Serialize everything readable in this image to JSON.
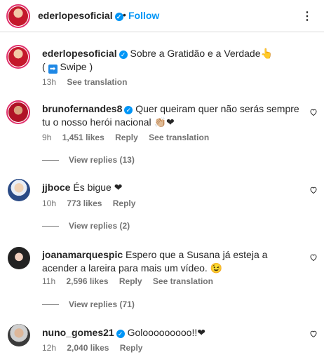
{
  "header": {
    "username": "ederlopesoficial",
    "verified_mark": "✓",
    "separator": "•",
    "follow_label": "Follow",
    "more_icon": "⋮"
  },
  "caption": {
    "username": "ederlopesoficial",
    "text": "Sobre a Gratidão e a Verdade👆",
    "text2_pre": "(",
    "swipe_icon": "➡",
    "text2_post": "Swipe )",
    "time": "13h",
    "see_translation": "See translation"
  },
  "comments": [
    {
      "username": "brunofernandes8",
      "verified": true,
      "text": "Quer queiram quer não serás sempre tu o nosso herói nacional 👏🏼❤",
      "time": "9h",
      "likes": "1,451 likes",
      "reply": "Reply",
      "see_translation": "See translation",
      "view_replies": "View replies (13)"
    },
    {
      "username": "jjboce",
      "verified": false,
      "text": "És bigue ❤",
      "time": "10h",
      "likes": "773 likes",
      "reply": "Reply",
      "view_replies": "View replies (2)"
    },
    {
      "username": "joanamarquespic",
      "verified": false,
      "text": "Espero que a Susana já esteja a acender a lareira para mais um vídeo. 😉",
      "time": "11h",
      "likes": "2,596 likes",
      "reply": "Reply",
      "see_translation": "See translation",
      "view_replies": "View replies (71)"
    },
    {
      "username": "nuno_gomes21",
      "verified": true,
      "text": "Golooooooooo!!❤",
      "time": "12h",
      "likes": "2,040 likes",
      "reply": "Reply"
    }
  ],
  "icons": {
    "heart_outline": "heart-outline-icon",
    "verified": "verified-badge-icon",
    "more": "more-options-icon"
  },
  "colors": {
    "link_blue": "#0095f6",
    "verified_blue": "#0095f6",
    "muted_text": "#737373",
    "heart_red": "#ed1c24"
  }
}
